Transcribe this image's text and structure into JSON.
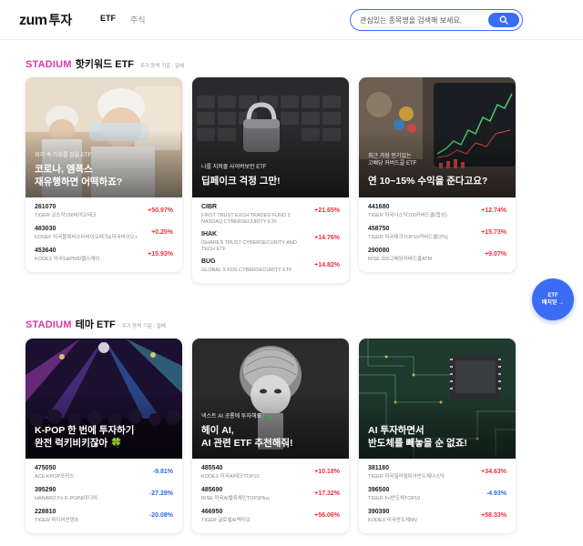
{
  "header": {
    "logo_brand": "zum",
    "logo_service": "투자",
    "nav": [
      {
        "label": "ETF"
      },
      {
        "label": "주식"
      }
    ],
    "search_placeholder": "관심있는 종목명을 검색해 보세요."
  },
  "sections": [
    {
      "tag": "STADIUM",
      "title": "핫키워드 ETF",
      "subtitle": "주가 등락 기준 : 일배",
      "cards": [
        {
          "small": "위기 속 기회를 잡을 ETF",
          "big": "코로나, 엠폭스\n재유행하면 어떡하죠?",
          "items": [
            {
              "code": "261070",
              "name": "TIGER 코스닥150바이오테크",
              "rate": "+50.97%",
              "dir": "up"
            },
            {
              "code": "483030",
              "name": "KOSEF 미국블록바스터바이오테크&미국바이오+",
              "rate": "+0.25%",
              "dir": "up"
            },
            {
              "code": "453640",
              "name": "KODEX 미국S&P500헬스케어",
              "rate": "+15.93%",
              "dir": "up"
            }
          ]
        },
        {
          "small": "나를 지켜줄 사이버보안 ETF",
          "big": "딥페이크 걱정 그만!",
          "items": [
            {
              "code": "CIBR",
              "name": "FIRST TRUST EXCH TRADED FUND 2 NASDAQ CYBERSECURITY ETF",
              "rate": "+21.65%",
              "dir": "up"
            },
            {
              "code": "IHAK",
              "name": "ISHARES TRUST CYBERSECURITY AND TECH ETF",
              "rate": "+14.76%",
              "dir": "up"
            },
            {
              "code": "BUG",
              "name": "GLOBAL X FDS CYBERSECURITY ETF",
              "rate": "+14.82%",
              "dir": "up"
            }
          ]
        },
        {
          "small": "최근 가장 인기있는\n고배당 커버드콜 ETF",
          "big": "연 10~15% 수익을 준다고요?",
          "items": [
            {
              "code": "441680",
              "name": "TIGER 미국나스닥100커버드콜(합성)",
              "rate": "+12.74%",
              "dir": "up"
            },
            {
              "code": "458750",
              "name": "TIGER 미국테크TOP10커버드콜(2%)",
              "rate": "+15.73%",
              "dir": "up"
            },
            {
              "code": "290080",
              "name": "RISE 200고배당커버드콜ATM",
              "rate": "+9.07%",
              "dir": "up"
            }
          ]
        }
      ]
    },
    {
      "tag": "STADIUM",
      "title": "테마 ETF",
      "subtitle": "주가 등락 기준 : 일배",
      "cards": [
        {
          "small": "",
          "big": "K-POP 한 번에 투자하기\n완전 럭키비키잖아 🍀",
          "items": [
            {
              "code": "475050",
              "name": "ACE KPOP포커스",
              "rate": "-9.81%",
              "dir": "down"
            },
            {
              "code": "395290",
              "name": "HANARO Fn K-POP&미디어",
              "rate": "-27.28%",
              "dir": "down"
            },
            {
              "code": "228810",
              "name": "TIGER 미디어컨텐츠",
              "rate": "-20.08%",
              "dir": "down"
            }
          ]
        },
        {
          "small": "넥스트 AI 공룡에 투자해요 🦕",
          "big": "헤이 AI,\nAI 관련 ETF 추천해줘!",
          "items": [
            {
              "code": "485540",
              "name": "KODEX 미국AI테크TOP10",
              "rate": "+10.18%",
              "dir": "up"
            },
            {
              "code": "485690",
              "name": "RISE 미국AI밸류체인TOP3Plus",
              "rate": "+17.32%",
              "dir": "up"
            },
            {
              "code": "466950",
              "name": "TIGER 글로벌AI액티브",
              "rate": "+56.06%",
              "dir": "up"
            }
          ]
        },
        {
          "small": "",
          "big": "AI 투자하면서\n반도체를 빼놓을 순 없죠!",
          "items": [
            {
              "code": "381180",
              "name": "TIGER 미국필라델피아반도체나스닥",
              "rate": "+34.63%",
              "dir": "up"
            },
            {
              "code": "396500",
              "name": "TIGER Fn반도체TOP10",
              "rate": "-4.93%",
              "dir": "down"
            },
            {
              "code": "390390",
              "name": "KODEX 미국반도체MV",
              "rate": "+58.33%",
              "dir": "up"
            }
          ]
        }
      ]
    }
  ],
  "floating": {
    "line1": "ETF",
    "line2": "배지얻 →"
  }
}
